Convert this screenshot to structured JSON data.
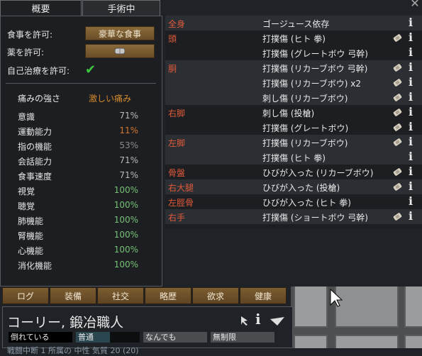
{
  "tabs": {
    "overview": "概要",
    "operations": "手術中"
  },
  "left": {
    "food_label": "食事を許可:",
    "food_value": "豪華な食事",
    "medicine_label": "薬を許可:",
    "self_tend_label": "自己治療を許可:",
    "pain_label": "痛みの強さ",
    "pain_value": "激しい痛み",
    "capacities": [
      {
        "name": "意識",
        "value": "71%",
        "color": "#b9b9b9"
      },
      {
        "name": "運動能力",
        "value": "11%",
        "color": "#d4752a"
      },
      {
        "name": "指の機能",
        "value": "53%",
        "color": "#8c8c8c"
      },
      {
        "name": "会話能力",
        "value": "71%",
        "color": "#b9b9b9"
      },
      {
        "name": "食事速度",
        "value": "71%",
        "color": "#b9b9b9"
      },
      {
        "name": "視覚",
        "value": "100%",
        "color": "#76c276"
      },
      {
        "name": "聴覚",
        "value": "100%",
        "color": "#76c276"
      },
      {
        "name": "肺機能",
        "value": "100%",
        "color": "#76c276"
      },
      {
        "name": "腎機能",
        "value": "100%",
        "color": "#76c276"
      },
      {
        "name": "心機能",
        "value": "100%",
        "color": "#76c276"
      },
      {
        "name": "消化機能",
        "value": "100%",
        "color": "#76c276"
      }
    ]
  },
  "health_rows": [
    {
      "part": "全身",
      "condition": "ゴージュース依存",
      "icon": false,
      "shade": true
    },
    {
      "part": "頭",
      "condition": "打撲傷 (ヒト 拳)",
      "icon": true,
      "shade": false
    },
    {
      "part": "",
      "condition": "打撲傷 (グレートボウ 弓幹)",
      "icon": false,
      "shade": false
    },
    {
      "part": "胴",
      "condition": "打撲傷 (リカーブボウ 弓幹)",
      "icon": true,
      "shade": true
    },
    {
      "part": "",
      "condition": "打撲傷 (リカーブボウ) x2",
      "icon": true,
      "shade": true
    },
    {
      "part": "",
      "condition": "刺し傷 (リカーブボウ)",
      "icon": true,
      "shade": true
    },
    {
      "part": "右脚",
      "condition": "刺し傷 (投槍)",
      "icon": true,
      "shade": false
    },
    {
      "part": "",
      "condition": "打撲傷 (グレートボウ)",
      "icon": true,
      "shade": false
    },
    {
      "part": "左脚",
      "condition": "打撲傷 (リカーブボウ)",
      "icon": true,
      "shade": true
    },
    {
      "part": "",
      "condition": "打撲傷 (ヒト 拳)",
      "icon": false,
      "shade": true
    },
    {
      "part": "骨盤",
      "condition": "ひびが入った (リカーブボウ)",
      "icon": true,
      "shade": false
    },
    {
      "part": "右大腿",
      "condition": "ひびが入った (投槍)",
      "icon": true,
      "shade": true
    },
    {
      "part": "左脛骨",
      "condition": "ひびが入った (ヒト 拳)",
      "icon": false,
      "shade": false
    },
    {
      "part": "右手",
      "condition": "打撲傷 (ショートボウ 弓幹)",
      "icon": true,
      "shade": true
    }
  ],
  "bottom_tabs": [
    "ログ",
    "装備",
    "社交",
    "略歴",
    "欲求",
    "健康"
  ],
  "pawn": {
    "name": "コーリー, 鍛冶職人",
    "mood": "倒れている",
    "food_restriction": "普通",
    "outfit": "なんでも",
    "drug_policy": "無制限",
    "status_line": "戦闘中断 1 所属の 中性 気質 20 (20)"
  },
  "colors": {
    "part_red": "#e05a3a",
    "accent_orange": "#d48a2a",
    "good_green": "#76c276"
  }
}
